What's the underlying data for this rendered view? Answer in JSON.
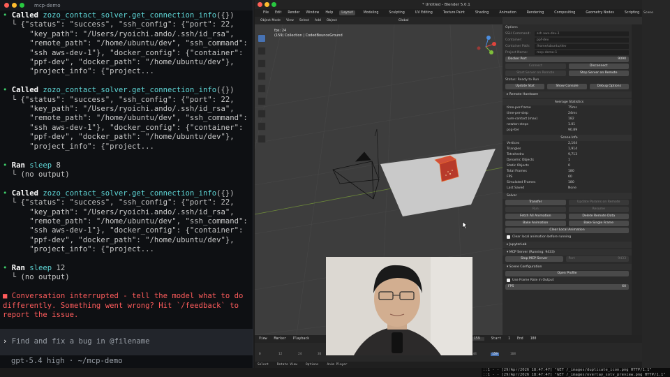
{
  "terminal": {
    "title": "mcp-demo",
    "lines": [
      {
        "kind": "call",
        "bullet": "•",
        "verb": "Called",
        "fn": "zozo_contact_solver.get_connection_info",
        "args": "({})"
      },
      {
        "kind": "out",
        "text": "  └ {\"status\": \"success\", \"ssh_config\": {\"port\": 22,"
      },
      {
        "kind": "out",
        "text": "      \"key_path\": \"/Users/ryoichi.ando/.ssh/id_rsa\","
      },
      {
        "kind": "out",
        "text": "      \"remote_path\": \"/home/ubuntu/dev\", \"ssh_command\":"
      },
      {
        "kind": "out",
        "text": "      \"ssh aws-dev-1\"}, \"docker_config\": {\"container\":"
      },
      {
        "kind": "out",
        "text": "      \"ppf-dev\", \"docker_path\": \"/home/ubuntu/dev\"},"
      },
      {
        "kind": "out",
        "text": "      \"project_info\": {\"project..."
      },
      {
        "kind": "blank",
        "text": ""
      },
      {
        "kind": "call",
        "bullet": "•",
        "verb": "Called",
        "fn": "zozo_contact_solver.get_connection_info",
        "args": "({})"
      },
      {
        "kind": "out",
        "text": "  └ {\"status\": \"success\", \"ssh_config\": {\"port\": 22,"
      },
      {
        "kind": "out",
        "text": "      \"key_path\": \"/Users/ryoichi.ando/.ssh/id_rsa\","
      },
      {
        "kind": "out",
        "text": "      \"remote_path\": \"/home/ubuntu/dev\", \"ssh_command\":"
      },
      {
        "kind": "out",
        "text": "      \"ssh aws-dev-1\"}, \"docker_config\": {\"container\":"
      },
      {
        "kind": "out",
        "text": "      \"ppf-dev\", \"docker_path\": \"/home/ubuntu/dev\"},"
      },
      {
        "kind": "out",
        "text": "      \"project_info\": {\"project..."
      },
      {
        "kind": "blank",
        "text": ""
      },
      {
        "kind": "call",
        "bullet": "•",
        "verb": "Ran",
        "fn": "sleep",
        "args": " 8"
      },
      {
        "kind": "out",
        "text": "  └ (no output)"
      },
      {
        "kind": "blank",
        "text": ""
      },
      {
        "kind": "call",
        "bullet": "•",
        "verb": "Called",
        "fn": "zozo_contact_solver.get_connection_info",
        "args": "({})"
      },
      {
        "kind": "out",
        "text": "  └ {\"status\": \"success\", \"ssh_config\": {\"port\": 22,"
      },
      {
        "kind": "out",
        "text": "      \"key_path\": \"/Users/ryoichi.ando/.ssh/id_rsa\","
      },
      {
        "kind": "out",
        "text": "      \"remote_path\": \"/home/ubuntu/dev\", \"ssh_command\":"
      },
      {
        "kind": "out",
        "text": "      \"ssh aws-dev-1\"}, \"docker_config\": {\"container\":"
      },
      {
        "kind": "out",
        "text": "      \"ppf-dev\", \"docker_path\": \"/home/ubuntu/dev\"},"
      },
      {
        "kind": "out",
        "text": "      \"project_info\": {\"project..."
      },
      {
        "kind": "blank",
        "text": ""
      },
      {
        "kind": "call",
        "bullet": "•",
        "verb": "Ran",
        "fn": "sleep",
        "args": " 12"
      },
      {
        "kind": "out",
        "text": "  └ (no output)"
      },
      {
        "kind": "blank",
        "text": ""
      },
      {
        "kind": "err",
        "text": "■ Conversation interrupted - tell the model what to do"
      },
      {
        "kind": "err",
        "text": "differently. Something went wrong? Hit `/feedback` to"
      },
      {
        "kind": "err",
        "text": "report the issue."
      }
    ],
    "input_prompt": "›",
    "input_placeholder": "Find and fix a bug in @filename",
    "status_line": "gpt-5.4 high · ~/mcp-demo"
  },
  "blender": {
    "window_title": "* Untitled - Blender 5.0.1",
    "menu": [
      "File",
      "Edit",
      "Render",
      "Window",
      "Help"
    ],
    "workspaces": [
      "Layout",
      "Modeling",
      "Sculpting",
      "UV Editing",
      "Texture Paint",
      "Shading",
      "Animation",
      "Rendering",
      "Compositing",
      "Geometry Nodes",
      "Scripting"
    ],
    "active_workspace": "Layout",
    "scene_label": "Scene",
    "header": {
      "mode": "Object Mode",
      "view": "View",
      "select": "Select",
      "add": "Add",
      "object": "Object",
      "orientation": "Global",
      "options": "Options"
    },
    "viewport_info": {
      "fps": "fps: 24",
      "collection": "(159) Collection | CodedBounceGround"
    },
    "panel": {
      "connection_fields": [
        {
          "key": "SSH Command:",
          "value": "ssh aws-dev-1"
        },
        {
          "key": "Container:",
          "value": "ppf-dev"
        },
        {
          "key": "Container Path:",
          "value": "/home/ubuntu/dev"
        },
        {
          "key": "Project Name:",
          "value": "mcp-demo-1"
        }
      ],
      "docker_port_label": "Docker Port",
      "docker_port_value": "9090",
      "connect": "Connect",
      "disconnect": "Disconnect",
      "start_server": "Start Server on Remote",
      "stop_server": "Stop Server on Remote",
      "status": "Status: Ready to Run",
      "update_stat": "Update Stat",
      "show_console": "Show Console",
      "debug_options": "Debug Options",
      "remote_hardware": "Remote Hardware",
      "avg_stats_title": "Average Statistics",
      "avg_stats": [
        [
          "time-per-frame",
          "75ms"
        ],
        [
          "time-per-step",
          "24ms"
        ],
        [
          "num-contact (max)",
          "182"
        ],
        [
          "newton-steps",
          "1.01"
        ],
        [
          "pcg-iter",
          "90.89"
        ]
      ],
      "scene_info_title": "Scene Info",
      "scene_info": [
        [
          "Vertices",
          "2,104"
        ],
        [
          "Triangles",
          "1,914"
        ],
        [
          "Tetrahedra",
          "9,713"
        ],
        [
          "Dynamic Objects",
          "1"
        ],
        [
          "Static Objects",
          "0"
        ],
        [
          "Total Frames",
          "180"
        ],
        [
          "FPS",
          "60"
        ],
        [
          "Simulated Frames",
          "180"
        ],
        [
          "Last Saved",
          "None"
        ]
      ],
      "solver_title": "Solver",
      "transfer": "Transfer",
      "update_params": "Update Params on Remote",
      "run": "Run",
      "resume": "Resume",
      "fetch_all": "Fetch All Animation",
      "delete_remote": "Delete Remote Data",
      "bake_animation": "Bake Animation",
      "bake_single": "Bake Single Frame",
      "clear_local": "Clear Local Animation",
      "clear_before_run": "Clear local animation before running",
      "jupyterlab": "JupyterLab",
      "mcp_server": "MCP Server (Running: 9433)",
      "stop_mcp": "Stop MCP Server",
      "port_label": "Port",
      "port_value": "9433",
      "scene_config": "Scene Configuration",
      "open_profile": "Open Profile",
      "use_frame_rate": "Use Frame Rate in Output",
      "fps_label": "FPS",
      "fps_value": "60"
    },
    "timeline": {
      "playback": "Playback",
      "view": "View",
      "marker": "Marker",
      "current_frame": "159",
      "start_label": "Start",
      "start": "1",
      "end_label": "End",
      "end": "180",
      "ticks": [
        "0",
        "12",
        "24",
        "36",
        "144",
        "159",
        "168"
      ]
    },
    "status_bar": [
      "Select",
      "Rotate View",
      "Options",
      "Anim Player"
    ]
  },
  "log_lines": [
    "::1 - - [29/Apr/2026 18:47:47] \"GET /_images/duplicate_icon.png HTTP/1.1\"",
    "::1 - - [29/Apr/2026 18:47:47] \"GET /_images/overlay_solv_preview.png HTTP/1.1\""
  ],
  "colors": {
    "terminal_bg": "#0e1013",
    "bullet_green": "#3ecf6a",
    "fn_cyan": "#5fd7d7",
    "error_red": "#ff5c5c",
    "blender_accent": "#4772b3",
    "cube_red": "#c0392b"
  }
}
